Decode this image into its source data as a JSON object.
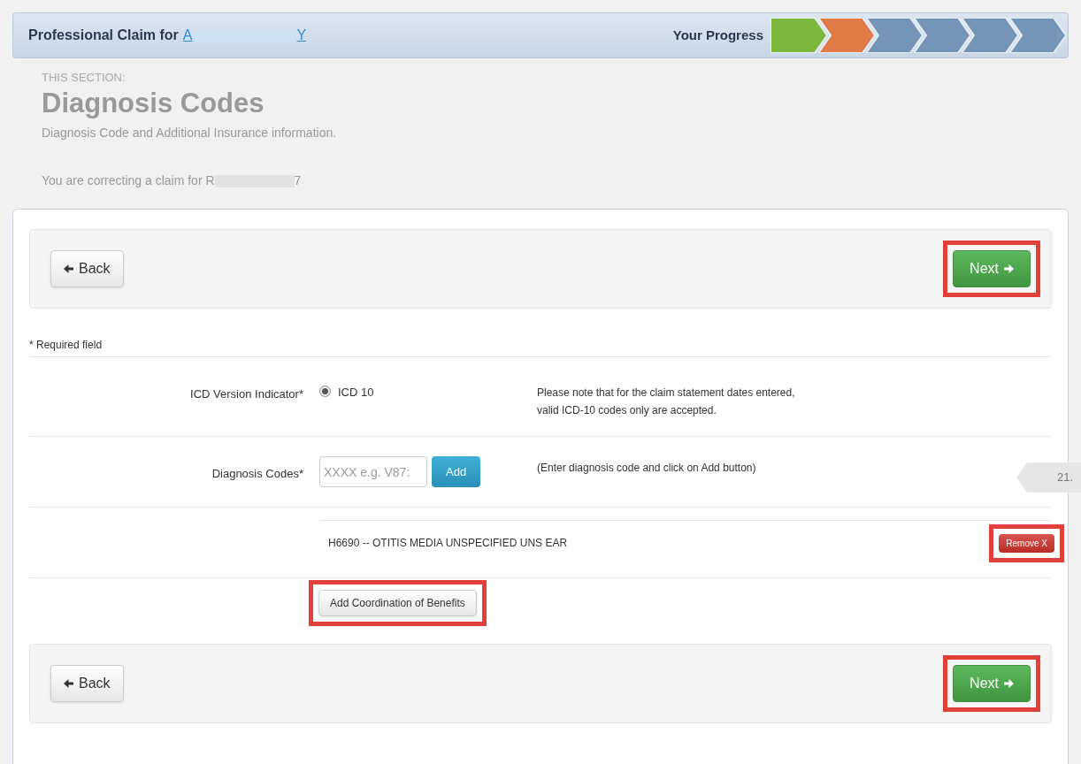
{
  "header": {
    "title": "Professional Claim for",
    "patient_start": "A",
    "patient_end": "Y",
    "progress_label": "Your Progress",
    "steps": [
      {
        "color": "#7cb83e"
      },
      {
        "color": "#e07a47"
      },
      {
        "color": "#7494b8"
      },
      {
        "color": "#7494b8"
      },
      {
        "color": "#7494b8"
      },
      {
        "color": "#7494b8"
      }
    ]
  },
  "section": {
    "eyebrow": "THIS SECTION:",
    "title": "Diagnosis Codes",
    "subtitle": "Diagnosis Code and Additional Insurance information.",
    "correcting_start": "You are correcting a claim for R",
    "correcting_end": "7"
  },
  "top_nav": {
    "back": {
      "label": "Back",
      "highlighted": false
    },
    "next": {
      "label": "Next",
      "highlighted": true
    }
  },
  "required_note": "* Required field",
  "icd": {
    "label": "ICD Version Indicator*",
    "option": {
      "label": "ICD 10",
      "selected": true
    },
    "note_lines": [
      "Please note that for the claim statement dates entered,",
      "valid ICD-10 codes only are accepted."
    ]
  },
  "diagnosis": {
    "label": "Diagnosis Codes*",
    "placeholder": "XXXX e.g. V87:",
    "add": "Add",
    "hint": "(Enter diagnosis code and click on Add button)",
    "side_tab": "21."
  },
  "codes": [
    {
      "text": "H6690 -- OTITIS MEDIA UNSPECIFIED UNS EAR",
      "remove": "Remove X",
      "highlighted": true
    }
  ],
  "cob": {
    "label": "Add Coordination of Benefits",
    "highlighted": true
  },
  "bottom_nav": {
    "back": {
      "label": "Back",
      "highlighted": false
    },
    "next": {
      "label": "Next",
      "highlighted": true
    }
  }
}
